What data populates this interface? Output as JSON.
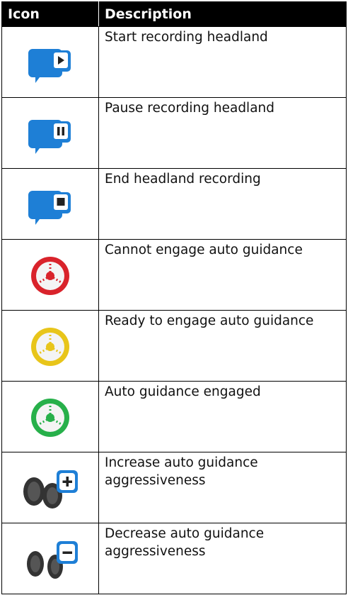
{
  "table": {
    "headers": {
      "icon": "Icon",
      "description": "Description"
    },
    "rows": [
      {
        "icon": "start-recording-headland-icon",
        "description": "Start recording headland"
      },
      {
        "icon": "pause-recording-headland-icon",
        "description": "Pause recording headland"
      },
      {
        "icon": "end-headland-recording-icon",
        "description": "End headland recording"
      },
      {
        "icon": "steering-wheel-red-icon",
        "description": "Cannot engage auto guidance"
      },
      {
        "icon": "steering-wheel-yellow-icon",
        "description": "Ready to engage auto guidance"
      },
      {
        "icon": "steering-wheel-green-icon",
        "description": "Auto guidance engaged"
      },
      {
        "icon": "wheels-plus-icon",
        "description": "Increase auto guidance aggressiveness"
      },
      {
        "icon": "wheels-minus-icon",
        "description": "Decrease auto guidance aggressiveness"
      }
    ]
  },
  "colors": {
    "record_blue": "#1e7fd6",
    "wheel_red": "#d9232b",
    "wheel_yellow": "#e8c51a",
    "wheel_green": "#27b04a",
    "tire_dark": "#333333"
  }
}
